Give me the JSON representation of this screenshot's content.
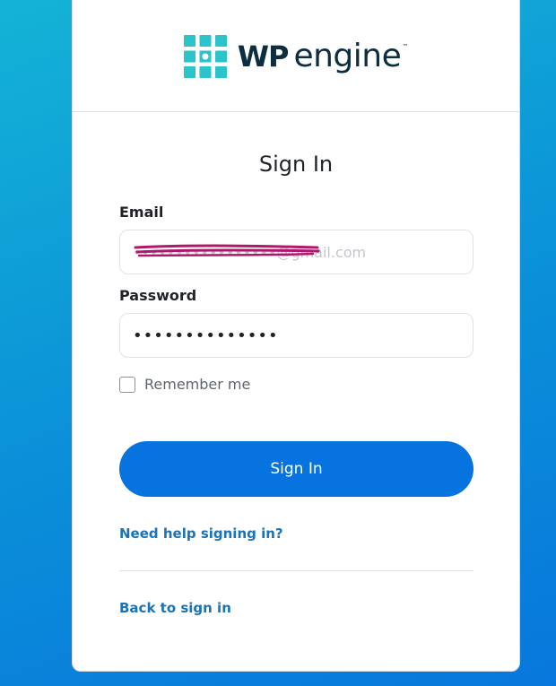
{
  "brand": {
    "name_bold": "WP",
    "name_light": "engine",
    "trademark": "™",
    "mark_color": "#2bc4cb",
    "text_color": "#0d2d40"
  },
  "form": {
    "title": "Sign In",
    "email_label": "Email",
    "email_value": "•••••••••••••••••@gmail.com",
    "password_label": "Password",
    "password_value": "••••••••••••••",
    "remember_label": "Remember me",
    "remember_checked": false,
    "submit_label": "Sign In",
    "help_link": "Need help signing in?",
    "back_link": "Back to sign in"
  },
  "colors": {
    "primary": "#0773de",
    "link": "#1a73b8",
    "redaction": "#b0196b"
  }
}
